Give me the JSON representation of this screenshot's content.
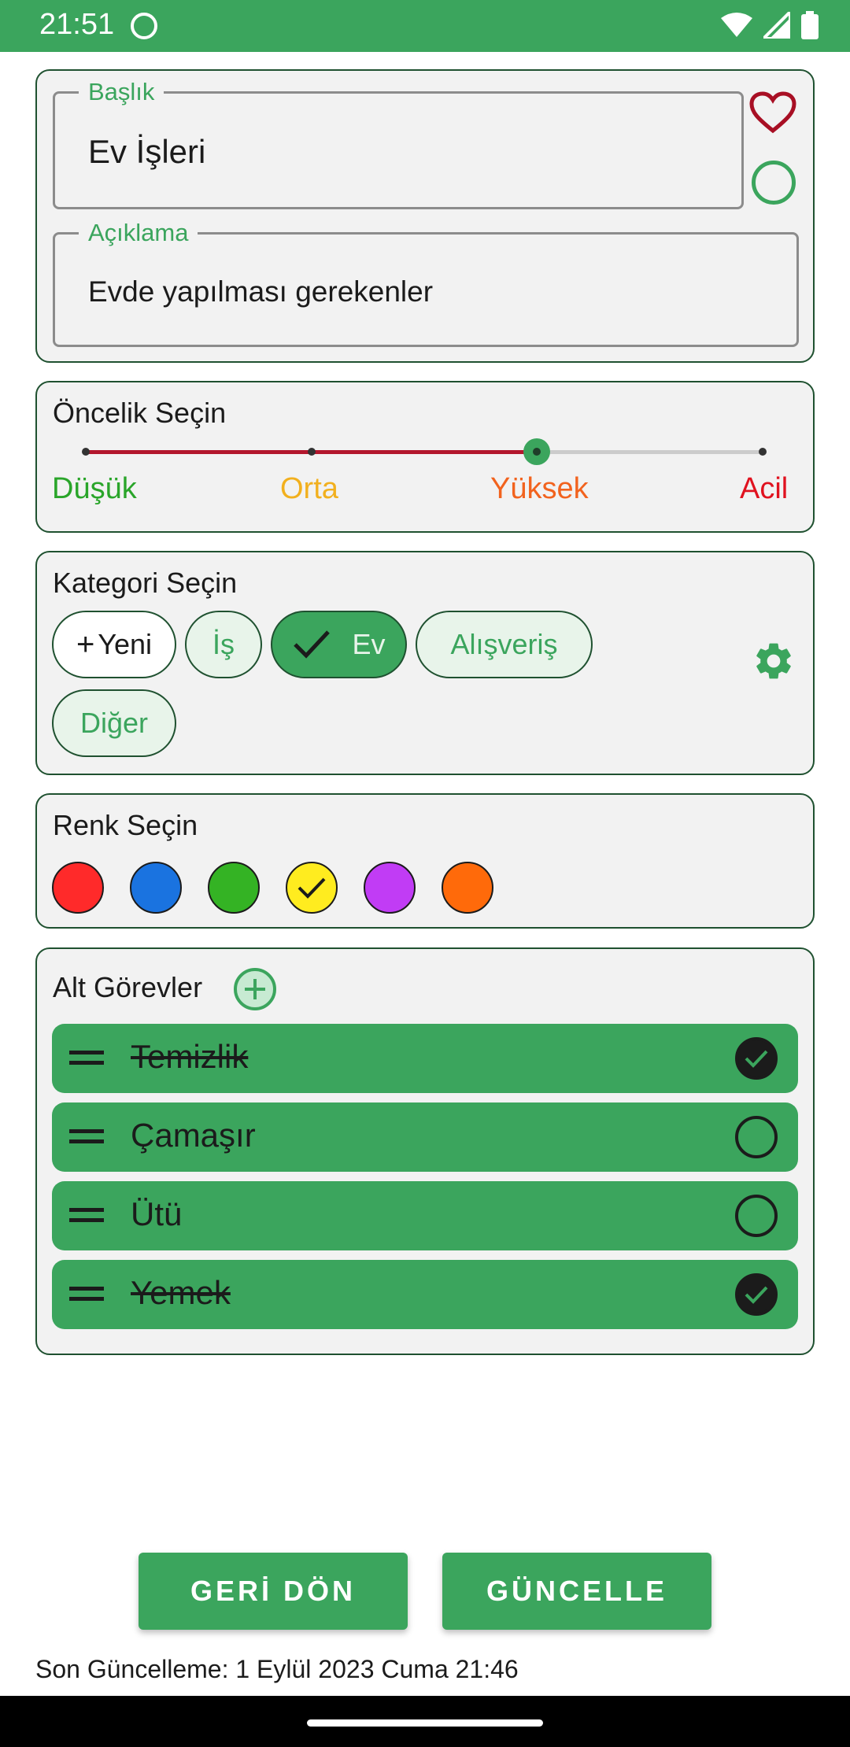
{
  "status_bar": {
    "time": "21:51"
  },
  "title_card": {
    "title_label": "Başlık",
    "title_value": "Ev İşleri",
    "description_label": "Açıklama",
    "description_value": "Evde yapılması gerekenler"
  },
  "priority": {
    "heading": "Öncelik Seçin",
    "levels": [
      "Düşük",
      "Orta",
      "Yüksek",
      "Acil"
    ],
    "selected_index": 2,
    "level_colors": [
      "#2aa52a",
      "#f2b01e",
      "#f2631e",
      "#e0121f"
    ]
  },
  "category": {
    "heading": "Kategori Seçin",
    "new_label": "Yeni",
    "chips": [
      "İş",
      "Ev",
      "Alışveriş",
      "Diğer"
    ],
    "selected": "Ev"
  },
  "color": {
    "heading": "Renk Seçin",
    "swatches": [
      "#ff2a2a",
      "#1a73e0",
      "#34b324",
      "#ffec1f",
      "#c13cf5",
      "#ff6a0a"
    ],
    "selected_index": 3
  },
  "subtasks": {
    "heading": "Alt Görevler",
    "items": [
      {
        "label": "Temizlik",
        "done": true
      },
      {
        "label": "Çamaşır",
        "done": false
      },
      {
        "label": "Ütü",
        "done": false
      },
      {
        "label": "Yemek",
        "done": true
      }
    ]
  },
  "actions": {
    "back_label": "GERİ DÖN",
    "update_label": "GÜNCELLE"
  },
  "footer": {
    "last_updated": "Son Güncelleme: 1 Eylül 2023 Cuma 21:46"
  },
  "colors": {
    "primary": "#3ba55d",
    "favorite": "#a80f24"
  }
}
